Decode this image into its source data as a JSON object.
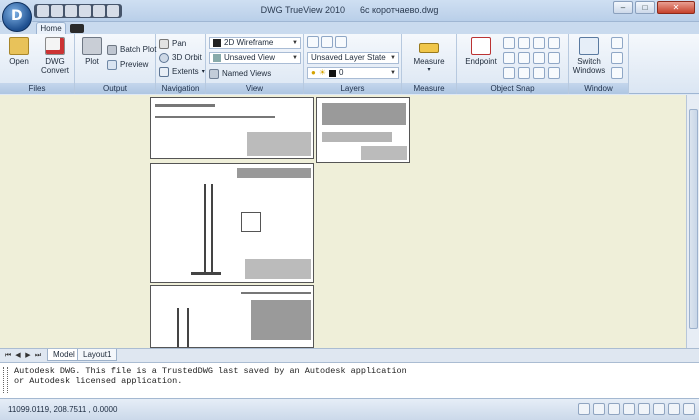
{
  "window": {
    "app_title": "DWG TrueView 2010",
    "file_name": "6с коротчаево.dwg"
  },
  "ribbon": {
    "tab_home": "Home",
    "files": {
      "title": "Files",
      "open": "Open",
      "dwg_convert_1": "DWG",
      "dwg_convert_2": "Convert"
    },
    "output": {
      "title": "Output",
      "plot": "Plot",
      "batch_plot": "Batch Plot",
      "preview": "Preview"
    },
    "navigation": {
      "title": "Navigation",
      "pan": "Pan",
      "orbit": "3D Orbit",
      "extents": "Extents"
    },
    "view": {
      "title": "View",
      "visual_style": "2D Wireframe",
      "saved_view": "Unsaved View",
      "named_views": "Named Views"
    },
    "layers": {
      "title": "Layers",
      "layer_state": "Unsaved Layer State",
      "layer_value": "0"
    },
    "measure": {
      "title": "Measure",
      "measure": "Measure"
    },
    "object_snap": {
      "title": "Object Snap",
      "endpoint": "Endpoint"
    },
    "window_panel": {
      "title": "Window",
      "switch_1": "Switch",
      "switch_2": "Windows"
    }
  },
  "layout_tabs": [
    "Model",
    "Layout1"
  ],
  "command_line": [
    "Autodesk DWG.  This file is a TrustedDWG last saved by an Autodesk application",
    "or Autodesk licensed application."
  ],
  "status": {
    "coordinates": "11099.0119, 208.7511 , 0.0000"
  },
  "colors": {
    "workspace": "#efefd9",
    "ribbon": "#dbe6f3",
    "accent": "#1e4f8f"
  }
}
